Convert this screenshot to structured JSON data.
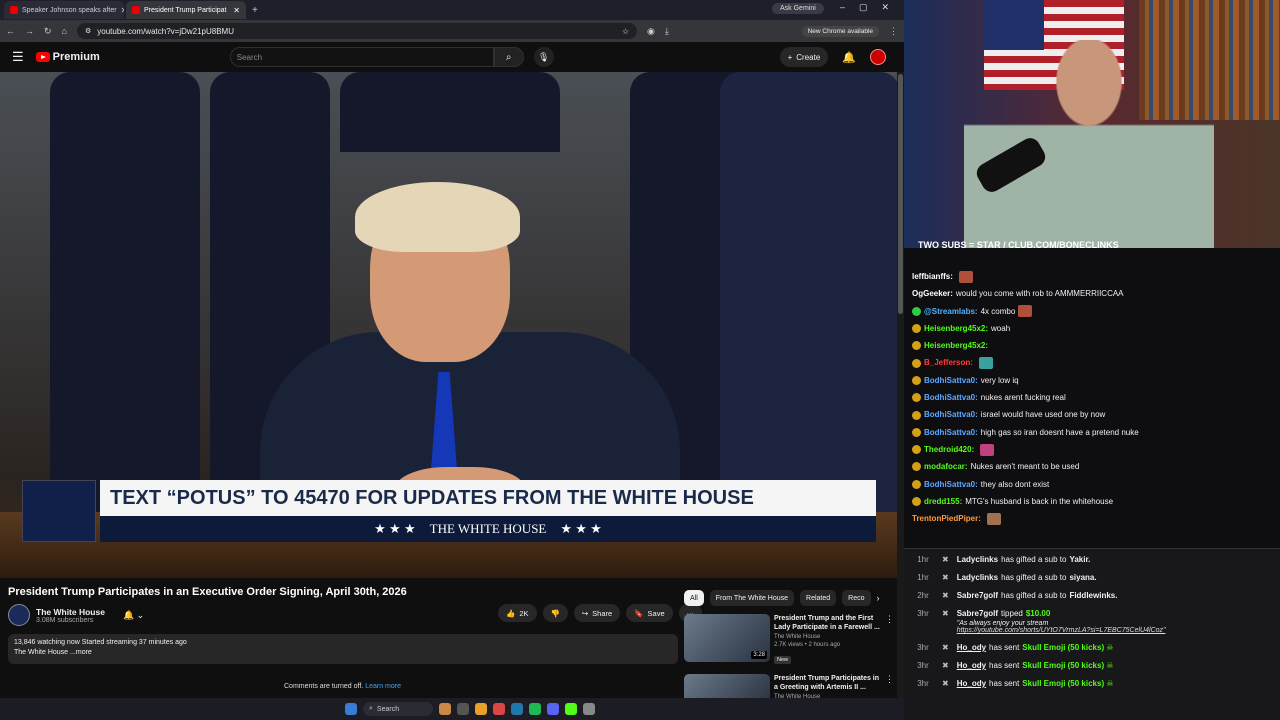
{
  "browser": {
    "tabs": [
      {
        "title": "Speaker Johnson speaks after",
        "active": false
      },
      {
        "title": "President Trump Participat",
        "active": true
      }
    ],
    "ask_gemini": "Ask Gemini",
    "url": "youtube.com/watch?v=jDw21pU8BMU",
    "chrome_update": "New Chrome available"
  },
  "youtube": {
    "logo_text": "Premium",
    "search_placeholder": "Search",
    "create_label": "Create",
    "video": {
      "lower_third": "TEXT “POTUS” TO 45470 FOR UPDATES FROM THE WHITE HOUSE",
      "lower_bar": "THE WHITE HOUSE",
      "stars_left": "★ ★ ★",
      "stars_right": "★ ★ ★"
    },
    "title": "President Trump Participates in an Executive Order Signing, April 30th, 2026",
    "channel": {
      "name": "The White House",
      "subscribers": "3.08M subscribers"
    },
    "actions": {
      "likes": "2K",
      "share": "Share",
      "save": "Save"
    },
    "description": {
      "stats": "13,846 watching now  Started streaming 37 minutes ago",
      "text": "The White House ...more"
    },
    "comments_off": "Comments are turned off.",
    "learn_more": "Learn more",
    "chips": [
      "All",
      "From The White House",
      "Related",
      "Reco"
    ],
    "recommendations": [
      {
        "title": "President Trump and the First Lady Participate in a Farewell ...",
        "channel": "The White House",
        "meta": "2.7K views • 2 hours ago",
        "duration": "3:28",
        "badge": "New"
      },
      {
        "title": "President Trump Participates in a Greeting with Artemis II ...",
        "channel": "The White House"
      }
    ]
  },
  "taskbar": {
    "search_label": "Search"
  },
  "stream": {
    "overlay": "TWO SUBS = STAR / CLUB.COM/BONECLINKS",
    "chat": [
      {
        "user": "leffbianffs:",
        "color": "#ffffff",
        "text": "",
        "emote": "#b0503a"
      },
      {
        "user": "OgGeeker:",
        "color": "#ffffff",
        "text": "would you come with rob to AMMMERRIICCAA"
      },
      {
        "user": "@Streamlabs:",
        "color": "#4fb3ff",
        "text": "4x    combo",
        "emote": "#b0503a",
        "badge": "#2ecc40"
      },
      {
        "user": "Heisenberg45x2:",
        "color": "#53fc18",
        "text": "woah",
        "badge": "#d4a017"
      },
      {
        "user": "Heisenberg45x2:",
        "color": "#53fc18",
        "text": "",
        "badge": "#d4a017"
      },
      {
        "user": "B_Jefferson:",
        "color": "#ff3b3b",
        "text": "",
        "emote": "#3aa0a0",
        "badge": "#d4a017"
      },
      {
        "user": "BodhiSattva0:",
        "color": "#5fa8ff",
        "text": "very low iq",
        "badge": "#d4a017"
      },
      {
        "user": "BodhiSattva0:",
        "color": "#5fa8ff",
        "text": "nukes arent fucking real",
        "badge": "#d4a017"
      },
      {
        "user": "BodhiSattva0:",
        "color": "#5fa8ff",
        "text": "israel would have used one by now",
        "badge": "#d4a017"
      },
      {
        "user": "BodhiSattva0:",
        "color": "#5fa8ff",
        "text": "high gas so iran doesnt have a pretend nuke",
        "badge": "#d4a017"
      },
      {
        "user": "Thedroid420:",
        "color": "#53fc18",
        "text": "",
        "emote": "#c04080",
        "badge": "#d4a017"
      },
      {
        "user": "modafocar:",
        "color": "#53fc18",
        "text": "Nukes aren't meant to be used",
        "badge": "#d4a017"
      },
      {
        "user": "BodhiSattva0:",
        "color": "#5fa8ff",
        "text": "they also dont exist",
        "badge": "#d4a017"
      },
      {
        "user": "dredd155:",
        "color": "#53fc18",
        "text": "MTG's husband is back in the whitehouse",
        "badge": "#d4a017"
      },
      {
        "user": "TrentonPiedPiper:",
        "color": "#ff9a3c",
        "text": "",
        "emote": "#a07050"
      }
    ],
    "events": [
      {
        "time": "1hr",
        "user": "Ladyclinks",
        "text": "has gifted a sub to",
        "target": "Yakir."
      },
      {
        "time": "1hr",
        "user": "Ladyclinks",
        "text": "has gifted a sub to",
        "target": "siyana."
      },
      {
        "time": "2hr",
        "user": "Sabre7golf",
        "text": "has gifted a sub to",
        "target": "Fiddlewinks."
      },
      {
        "time": "3hr",
        "user": "Sabre7golf",
        "text": "tipped",
        "target": "$10.00",
        "quote": "\"As always enjoy your stream",
        "link": "https://youtube.com/shorts/UYtO7VrmzLA?si=L7EBC75CelU4lCoz\""
      },
      {
        "time": "3hr",
        "user": "Ho_ody",
        "text": "has sent",
        "target": "Skull Emoji (50 kicks)"
      },
      {
        "time": "3hr",
        "user": "Ho_ody",
        "text": "has sent",
        "target": "Skull Emoji (50 kicks)"
      },
      {
        "time": "3hr",
        "user": "Ho_ody",
        "text": "has sent",
        "target": "Skull Emoji (50 kicks)"
      }
    ]
  }
}
